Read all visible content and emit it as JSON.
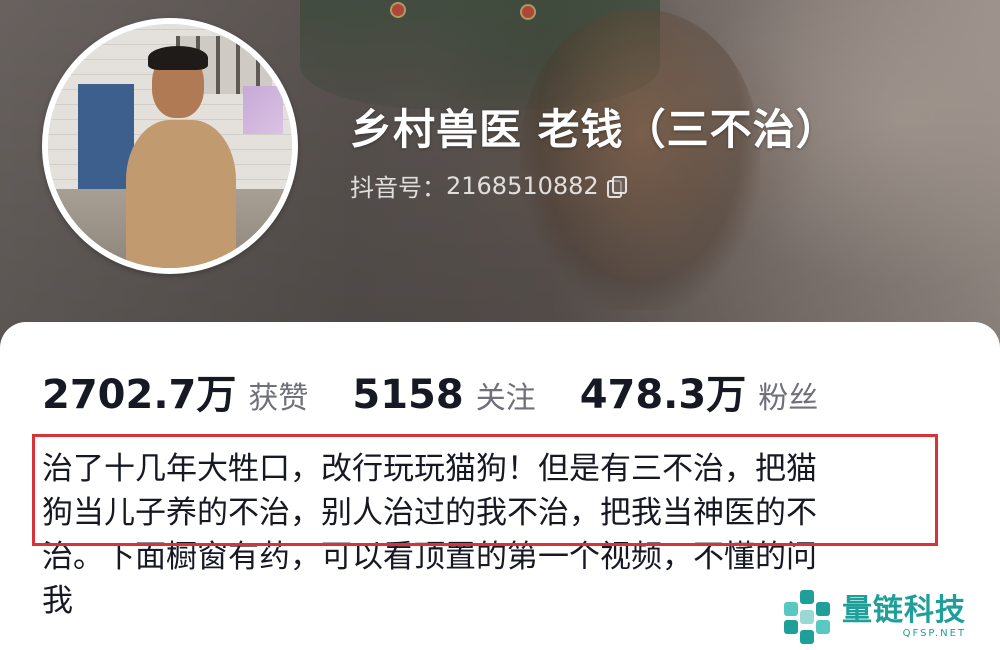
{
  "profile": {
    "name": "乡村兽医  老钱（三不治）",
    "douyin_id_label": "抖音号：",
    "douyin_id": "2168510882",
    "avatar_icon": "avatar-photo"
  },
  "stats": [
    {
      "value": "2702.7万",
      "label": "获赞"
    },
    {
      "value": "5158",
      "label": "关注"
    },
    {
      "value": "478.3万",
      "label": "粉丝"
    }
  ],
  "bio": {
    "lines": [
      "治了十几年大牲口，改行玩玩猫狗！但是有三不治，把猫",
      "狗当儿子养的不治，别人治过的我不治，把我当神医的不",
      "治。下面橱窗有药，可以看顶置的第一个视频，不懂的问",
      "我"
    ]
  },
  "watermark": {
    "title": "量链科技",
    "url": "QFSP.NET"
  },
  "colors": {
    "highlight": "#d9333a",
    "watermark": "#1f9f9a",
    "text": "#161823",
    "muted": "#6f7079"
  }
}
